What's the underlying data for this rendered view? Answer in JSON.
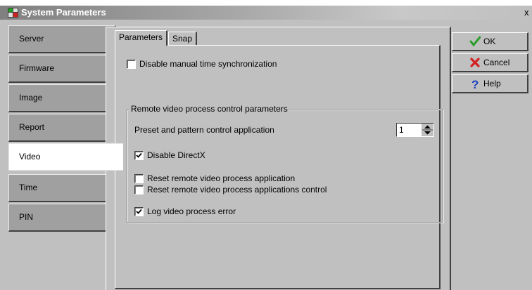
{
  "window": {
    "title": "System Parameters",
    "close_glyph": "x"
  },
  "left_tabs": [
    {
      "label": "Server"
    },
    {
      "label": "Firmware"
    },
    {
      "label": "Image"
    },
    {
      "label": "Report"
    },
    {
      "label": "Video",
      "active": true
    },
    {
      "label": "Time"
    },
    {
      "label": "PIN"
    }
  ],
  "inner_tabs": [
    {
      "label": "Parameters",
      "active": true
    },
    {
      "label": "Snap"
    }
  ],
  "parameters": {
    "disable_manual_sync": {
      "label": "Disable manual time synchronization",
      "checked": false
    },
    "group_title": "Remote video process control parameters",
    "preset_label": "Preset and pattern control application",
    "preset_value": "1",
    "disable_directx": {
      "label": "Disable DirectX",
      "checked": true
    },
    "reset_app": {
      "label": "Reset remote video process application",
      "checked": false
    },
    "reset_app_control": {
      "label": "Reset remote video process applications control",
      "checked": false
    },
    "log_error": {
      "label": "Log video process error",
      "checked": true
    }
  },
  "buttons": {
    "ok": "OK",
    "cancel": "Cancel",
    "help": "Help"
  },
  "colors": {
    "face": "#c0c0c0",
    "ok_check": "#2a9d2a",
    "cancel_x": "#d22020",
    "help_q": "#1a3fbf"
  }
}
